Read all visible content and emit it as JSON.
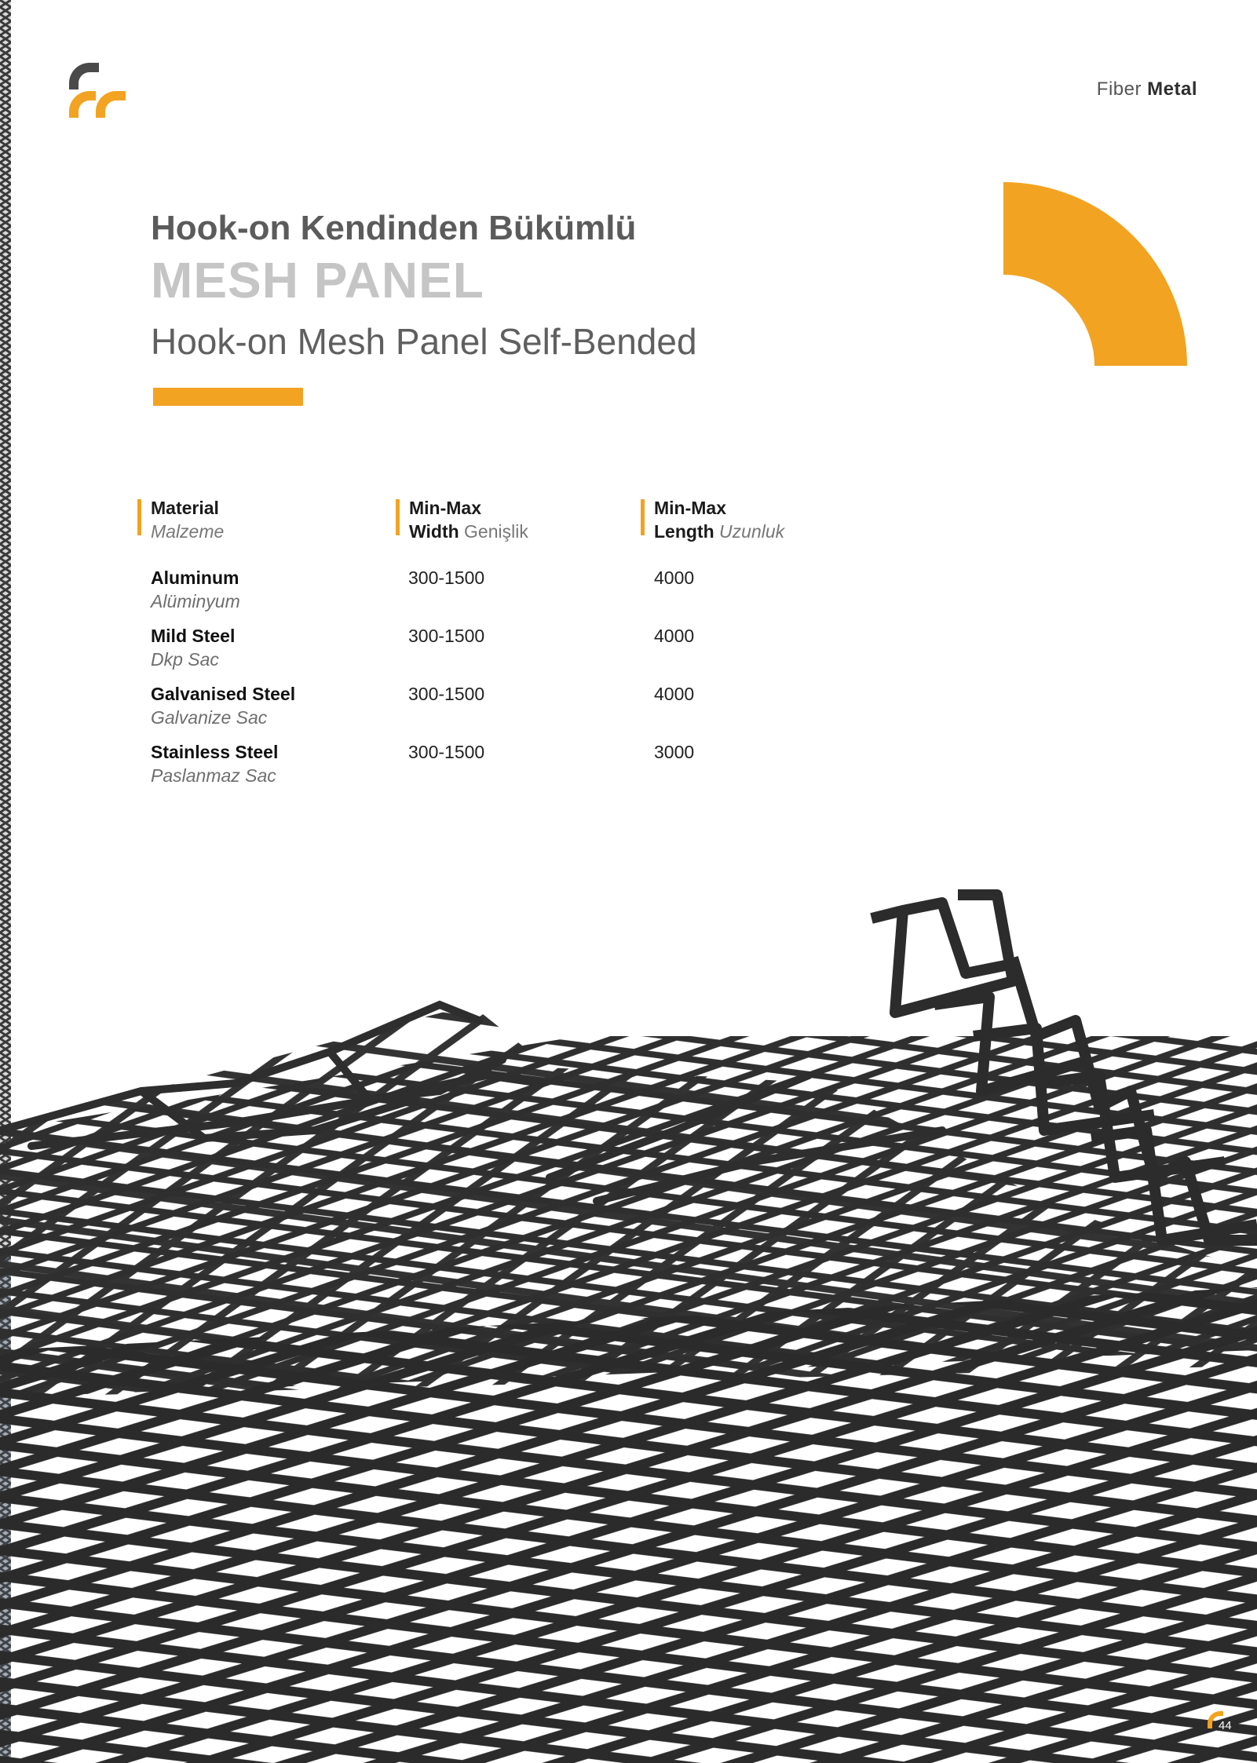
{
  "brand": {
    "light": "Fiber",
    "bold": "Metal"
  },
  "colors": {
    "accent": "#f2a321",
    "dark": "#4a4a4a",
    "mesh": "#2f2f2f"
  },
  "title": {
    "kicker": "Hook-on Kendinden Bükümlü",
    "headline": "MESH PANEL",
    "subtitle": "Hook-on Mesh Panel Self-Bended"
  },
  "table": {
    "columns": [
      {
        "line1": "Material",
        "line2_italic": "Malzeme"
      },
      {
        "line1": "Min-Max",
        "line2_bold": "Width",
        "line2_rest": " Genişlik"
      },
      {
        "line1": "Min-Max",
        "line2_bold": "Length",
        "line2_rest_italic": " Uzunluk"
      }
    ],
    "rows": [
      {
        "name": "Aluminum",
        "name_tr": "Alüminyum",
        "width": "300-1500",
        "length": "4000"
      },
      {
        "name": "Mild Steel",
        "name_tr": "Dkp Sac",
        "width": "300-1500",
        "length": "4000"
      },
      {
        "name": "Galvanised Steel",
        "name_tr": "Galvanize Sac",
        "width": "300-1500",
        "length": "4000"
      },
      {
        "name": "Stainless Steel",
        "name_tr": "Paslanmaz Sac",
        "width": "300-1500",
        "length": "3000"
      }
    ]
  },
  "page_number": "44"
}
